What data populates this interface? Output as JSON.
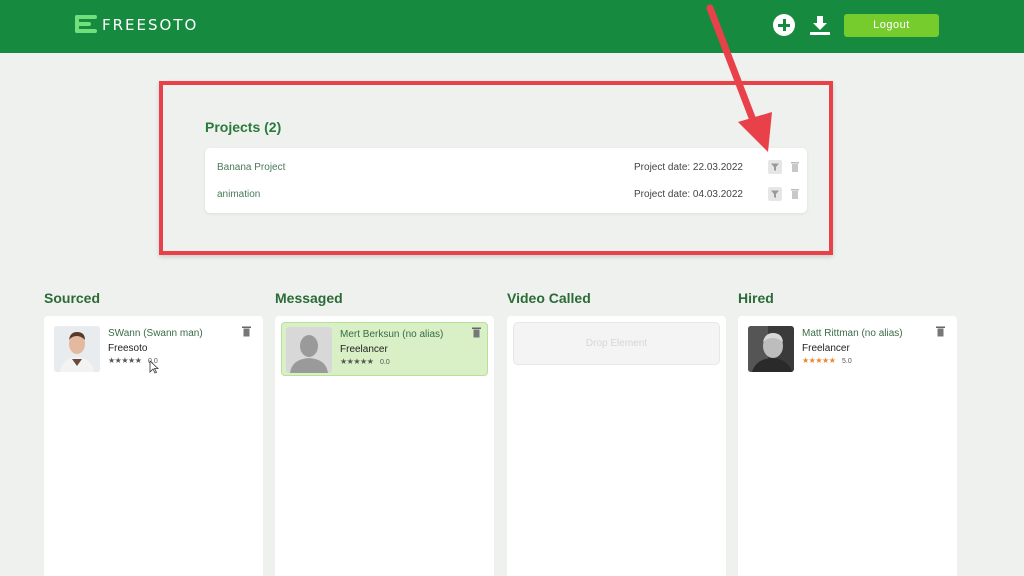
{
  "header": {
    "logo_text": "FREESOTO",
    "add_icon": "plus-circle-icon",
    "download_icon": "download-icon",
    "logout_label": "Logout",
    "brand_color": "#168a3e",
    "accent_color": "#76cc2d"
  },
  "projects": {
    "title": "Projects (2)",
    "items": [
      {
        "name": "Banana Project",
        "date": "Project date: 22.03.2022"
      },
      {
        "name": "animation",
        "date": "Project date: 04.03.2022"
      }
    ]
  },
  "highlight_color": "#e8414a",
  "columns": [
    {
      "title": "Sourced",
      "candidate": {
        "name": "SWann (Swann man)",
        "type": "Freesoto",
        "stars": "★★★★★",
        "rating": "0.0"
      }
    },
    {
      "title": "Messaged",
      "candidate": {
        "name": "Mert Berksun (no alias)",
        "type": "Freelancer",
        "stars": "★★★★★",
        "rating": "0.0"
      }
    },
    {
      "title": "Video Called",
      "drop_label": "Drop Element"
    },
    {
      "title": "Hired",
      "candidate": {
        "name": "Matt Rittman (no alias)",
        "type": "Freelancer",
        "stars": "★★★★★",
        "rating": "5.0"
      }
    }
  ]
}
